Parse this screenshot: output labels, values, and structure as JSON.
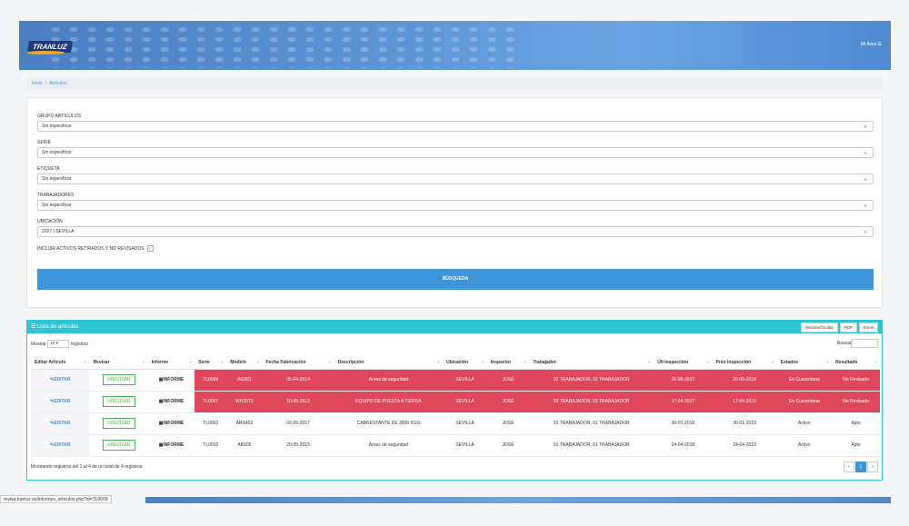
{
  "header": {
    "logo": "TRANLUZ",
    "user_menu": "Mi Área ☰"
  },
  "breadcrumb": {
    "home": "Inicio",
    "sep": "/",
    "current": "Artículos"
  },
  "filters": {
    "group_label": "GRUPO ARTICULOS",
    "group_value": "Sin especificar",
    "serie_label": "SERIE",
    "serie_value": "Sin especificar",
    "etiqueta_label": "ETIQUETA",
    "etiqueta_value": "Sin especificar",
    "trab_label": "TRABAJADORES",
    "trab_value": "Sin especificar",
    "ubic_label": "UBICACIÓN",
    "ubic_value": "2027 | SEVILLA",
    "include_label": "INCLUIR ACTIVOS RETIRADOS Y NO REVISADOS",
    "include_checked": "✓",
    "search_button": "BÚSQUEDA"
  },
  "panel": {
    "title": "☰ Lista de artículos",
    "btn_toggle": "Mostrar/Ocultar",
    "btn_pdf": "PDF",
    "btn_excel": "Excel",
    "show_label": "Mostrar",
    "show_value": "10",
    "show_suffix": "registros",
    "search_label": "Buscar:",
    "columns": [
      "Editar Artículo",
      "Revisar",
      "Informe",
      "Serie",
      "Modelo",
      "Fecha Fabricación",
      "Descripción",
      "Ubicación",
      "Inspector",
      "Trabajador",
      "Últ Inspección",
      "Próx Inspección",
      "Estados",
      "Resultado"
    ],
    "rows": [
      {
        "edit": "✎EDITAR",
        "rev": "⟳REVISAR",
        "inf": "▣INFORME",
        "serie": "TL0009",
        "modelo": "AG551",
        "fecha": "05-04-2014",
        "desc": "Arnes de seguridad",
        "ubic": "SEVILLA",
        "insp": "JOSÉ",
        "trab": "02 TRABAJADOR, 02 TRABAJADOR",
        "ult": "20-05-2017",
        "prox": "20-05-2018",
        "estado": "En Cuarentena",
        "res": "No Revisado"
      },
      {
        "edit": "✎EDITAR",
        "rev": "⟳REVISAR",
        "inf": "▣INFORME",
        "serie": "TL0007",
        "modelo": "WH20T2",
        "fecha": "10-05-2012",
        "desc": "EQUIPO DE PUESTA A TIERRA",
        "ubic": "SEVILLA",
        "insp": "JOSÉ",
        "trab": "03 TRABAJADOR, 03 TRABAJADOR",
        "ult": "17-04-2017",
        "prox": "17-04-2018",
        "estado": "En Cuarentena",
        "res": "No Revisado"
      },
      {
        "edit": "✎EDITAR",
        "rev": "⟳REVISAR",
        "inf": "▣INFORME",
        "serie": "TL0002",
        "modelo": "ARS403",
        "fecha": "02-05-2017",
        "desc": "CABRESTANTE DE 3500 KGS",
        "ubic": "SEVILLA",
        "insp": "JOSÉ",
        "trab": "01 TRABAJADOR, 01 TRABAJADOR",
        "ult": "30-01-2018",
        "prox": "30-01-2019",
        "estado": "Activo",
        "res": "Apto"
      },
      {
        "edit": "✎EDITAR",
        "rev": "⟳REVISAR",
        "inf": "▣INFORME",
        "serie": "TL0010",
        "modelo": "AB105",
        "fecha": "20-05-2015",
        "desc": "Arnes de seguridad",
        "ubic": "SEVILLA",
        "insp": "JOSÉ",
        "trab": "01 TRABAJADOR, 01 TRABAJADOR",
        "ult": "24-04-2018",
        "prox": "24-04-2019",
        "estado": "Activo",
        "res": "Apto"
      }
    ],
    "footer": "Mostrando registros del 1 al 4 de un total de 4 registros",
    "pag_prev": "‹",
    "pag_current": "1",
    "pag_next": "›"
  },
  "status_url": "revisa.tranluz.es/informes_articulos.php?id=TL0009"
}
